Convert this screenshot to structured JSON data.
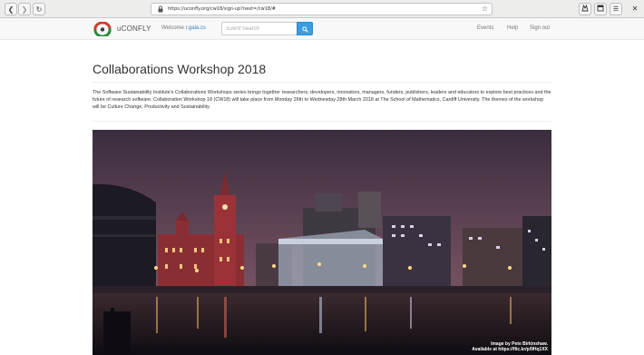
{
  "browser": {
    "url": "https://uconfly.org/cw18/sign-up?next=/cw18/#",
    "back_icon": "chevron-left-icon",
    "forward_icon": "chevron-right-icon",
    "reload_icon": "reload-icon",
    "bookmark_icon": "star-icon"
  },
  "site": {
    "brand": "uCONFLY",
    "welcome_prefix": "Welcome",
    "username": "r.gaia.cs",
    "search_placeholder": "Event Search",
    "nav": [
      "Events",
      "Help",
      "Sign out"
    ]
  },
  "page": {
    "title": "Collaborations Workshop 2018",
    "description": "The Software Sustainability Institute's Collaborations Workshops series brings together researchers, developers, innovators, managers, funders, publishers, leaders and educators to explore best practices and the future of research software. Collaboration Workshop 18 (CW18) will take place from Monday 26th to Wednesday 28th March 2018 at The School of Mathematics, Cardiff University. The themes of the workshop will be Culture Change, Productivity and Sustainability.",
    "image_credit_line1": "Image by Pete Birkinshaw.",
    "image_credit_line2": "Available at https://flic.kr/p/9Hq1XX"
  },
  "colors": {
    "accent": "#3d9ce0",
    "link": "#3a7ec4"
  }
}
